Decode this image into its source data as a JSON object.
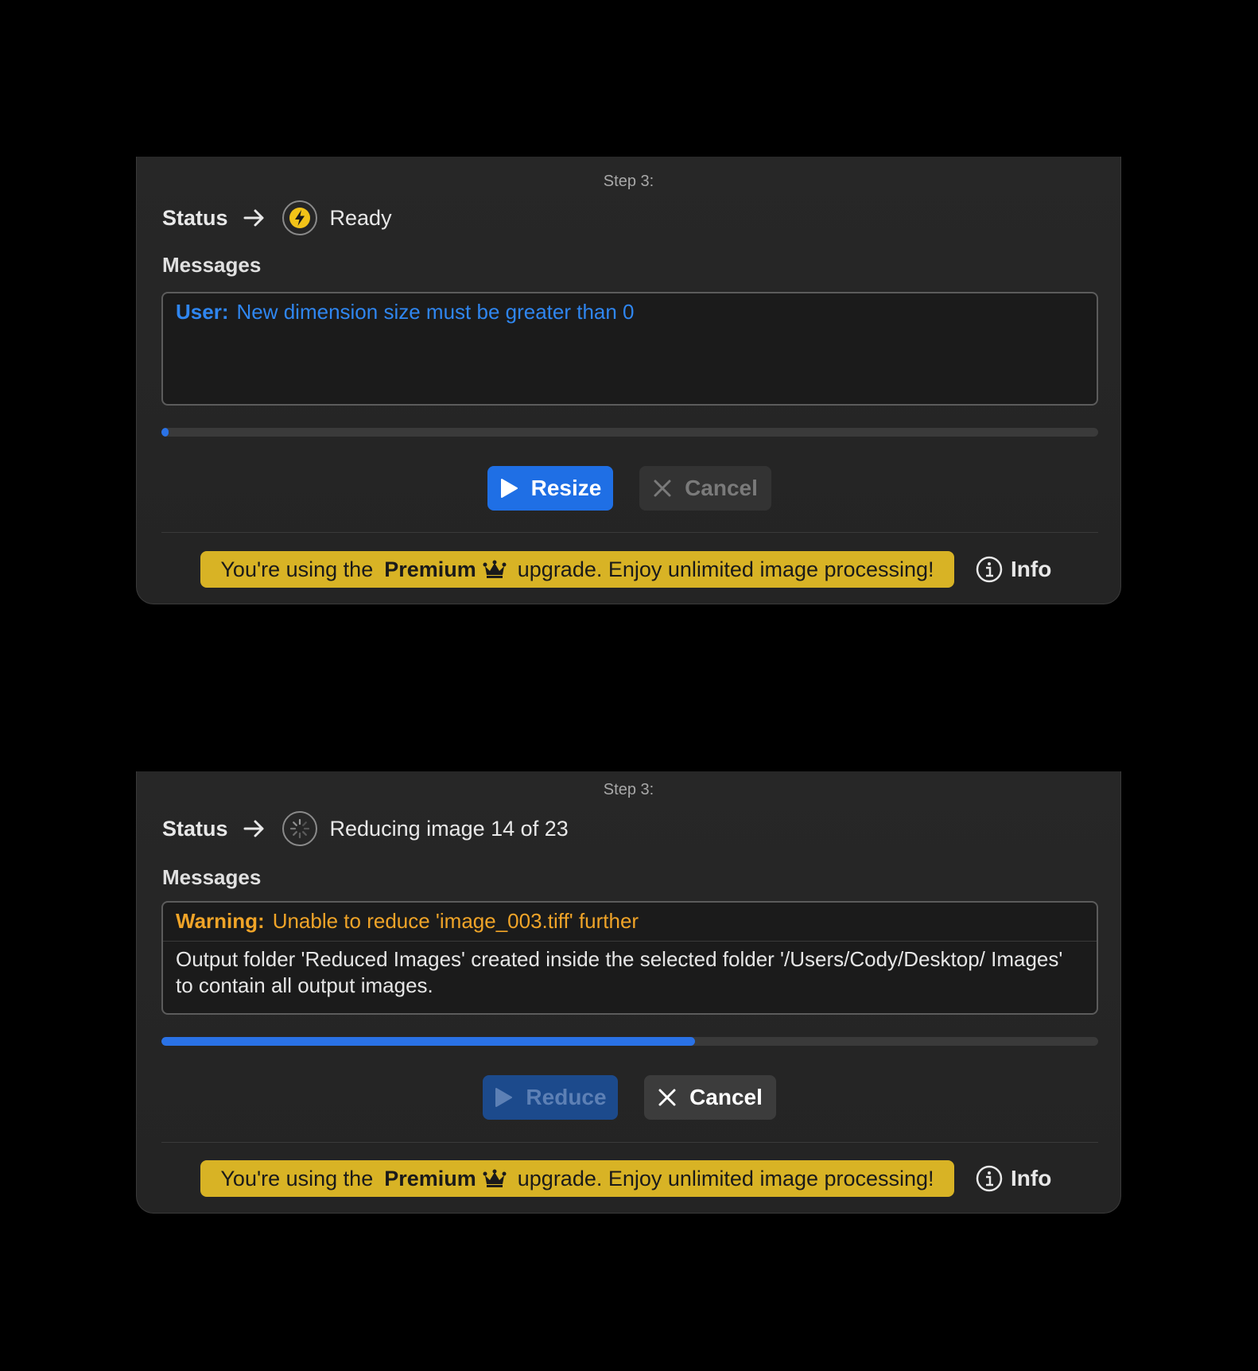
{
  "panels": [
    {
      "step_label": "Step 3:",
      "status_title": "Status",
      "status_icon": "lightning-icon",
      "status_text": "Ready",
      "messages_title": "Messages",
      "messages": [
        {
          "tag": "User:",
          "text": "New dimension size must be greater than 0",
          "type": "user"
        }
      ],
      "progress": 0.005,
      "primary_button": {
        "label": "Resize",
        "enabled": true
      },
      "cancel_button": {
        "label": "Cancel",
        "enabled": false
      },
      "banner": {
        "prefix": "You're using the",
        "strong": "Premium",
        "suffix": "upgrade. Enjoy unlimited image processing!"
      },
      "info_label": "Info"
    },
    {
      "step_label": "Step 3:",
      "status_title": "Status",
      "status_icon": "spinner-icon",
      "status_text": "Reducing image 14 of 23",
      "messages_title": "Messages",
      "messages": [
        {
          "tag": "Warning:",
          "text": "Unable to reduce 'image_003.tiff' further",
          "type": "warning"
        },
        {
          "tag": "",
          "text": "Output folder 'Reduced Images' created inside the selected folder '/Users/Cody/Desktop/ Images' to contain all output images.",
          "type": "plain"
        }
      ],
      "progress": 0.57,
      "primary_button": {
        "label": "Reduce",
        "enabled": false
      },
      "cancel_button": {
        "label": "Cancel",
        "enabled": true
      },
      "banner": {
        "prefix": "You're using the",
        "strong": "Premium",
        "suffix": "upgrade. Enjoy unlimited image processing!"
      },
      "info_label": "Info"
    }
  ],
  "colors": {
    "accent": "#1f6fe5",
    "user_message": "#2f86f0",
    "warning": "#f0a428",
    "premium": "#d8b325"
  }
}
